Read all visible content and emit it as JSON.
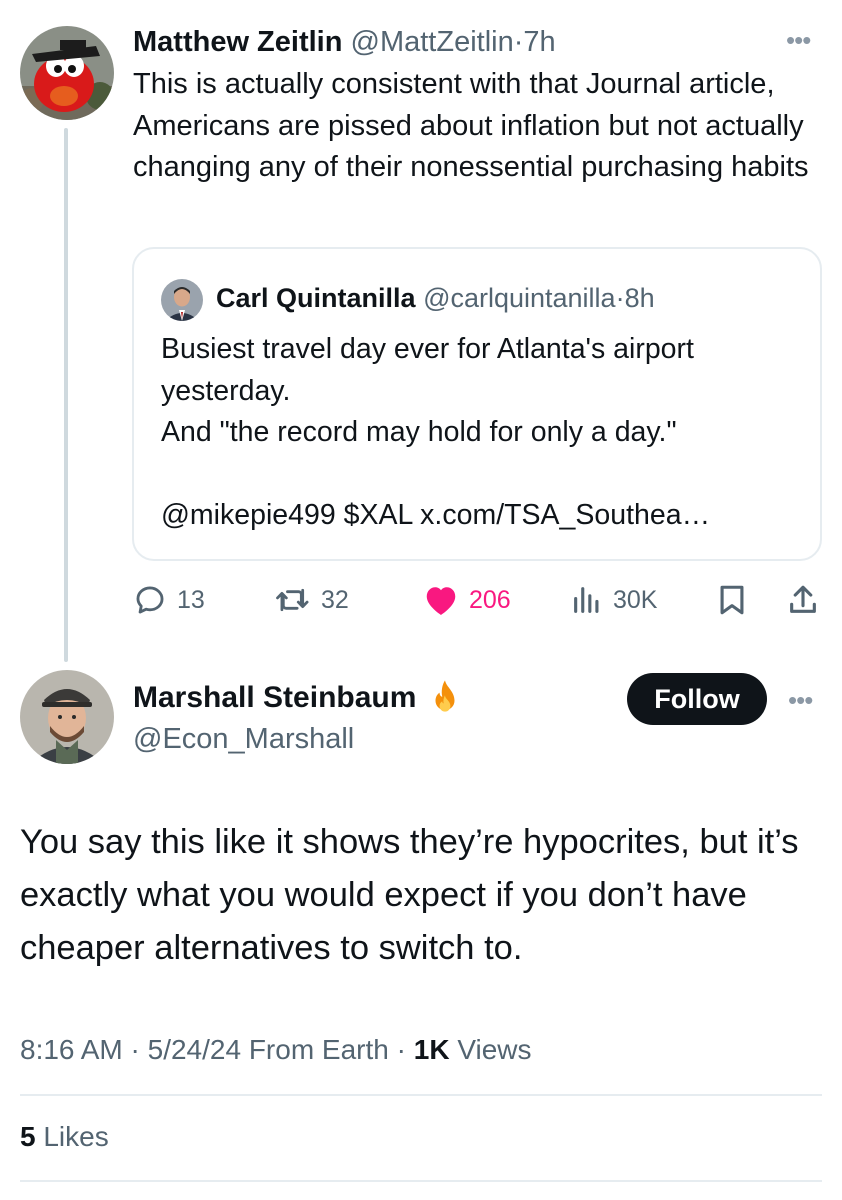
{
  "parent_tweet": {
    "name": "Matthew Zeitlin",
    "handle": "@MattZeitlin",
    "separator": "·",
    "time": "7h",
    "text": "This is actually consistent with that Journal article, Americans are pissed about inflation but not actually changing any of their nonessential purchasing habits",
    "avatar_icon": "elmo-avatar",
    "more_icon": "more-icon"
  },
  "quoted_tweet": {
    "name": "Carl Quintanilla",
    "handle": "@carlquintanilla",
    "separator": "·",
    "time": "8h",
    "text": "Busiest travel day ever for Atlanta's airport yesterday.\nAnd \"the record may hold for only a day.\"\n\n@mikepie499 $XAL x.com/TSA_Southea…"
  },
  "actions": {
    "replies": "13",
    "retweets": "32",
    "likes": "206",
    "views": "30K",
    "like_color": "#f91880"
  },
  "reply_tweet": {
    "name": "Marshall Steinbaum",
    "handle": "@Econ_Marshall",
    "follow_label": "Follow",
    "text": "You say this like it shows they’re hypocrites, but it’s exactly what you would expect if you don’t have cheaper alternatives to switch to.",
    "time": "8:16 AM",
    "separator": "·",
    "date": "5/24/24",
    "source": "From Earth",
    "views_count": "1K",
    "views_label": "Views",
    "likes_count": "5",
    "likes_label": "Likes"
  }
}
